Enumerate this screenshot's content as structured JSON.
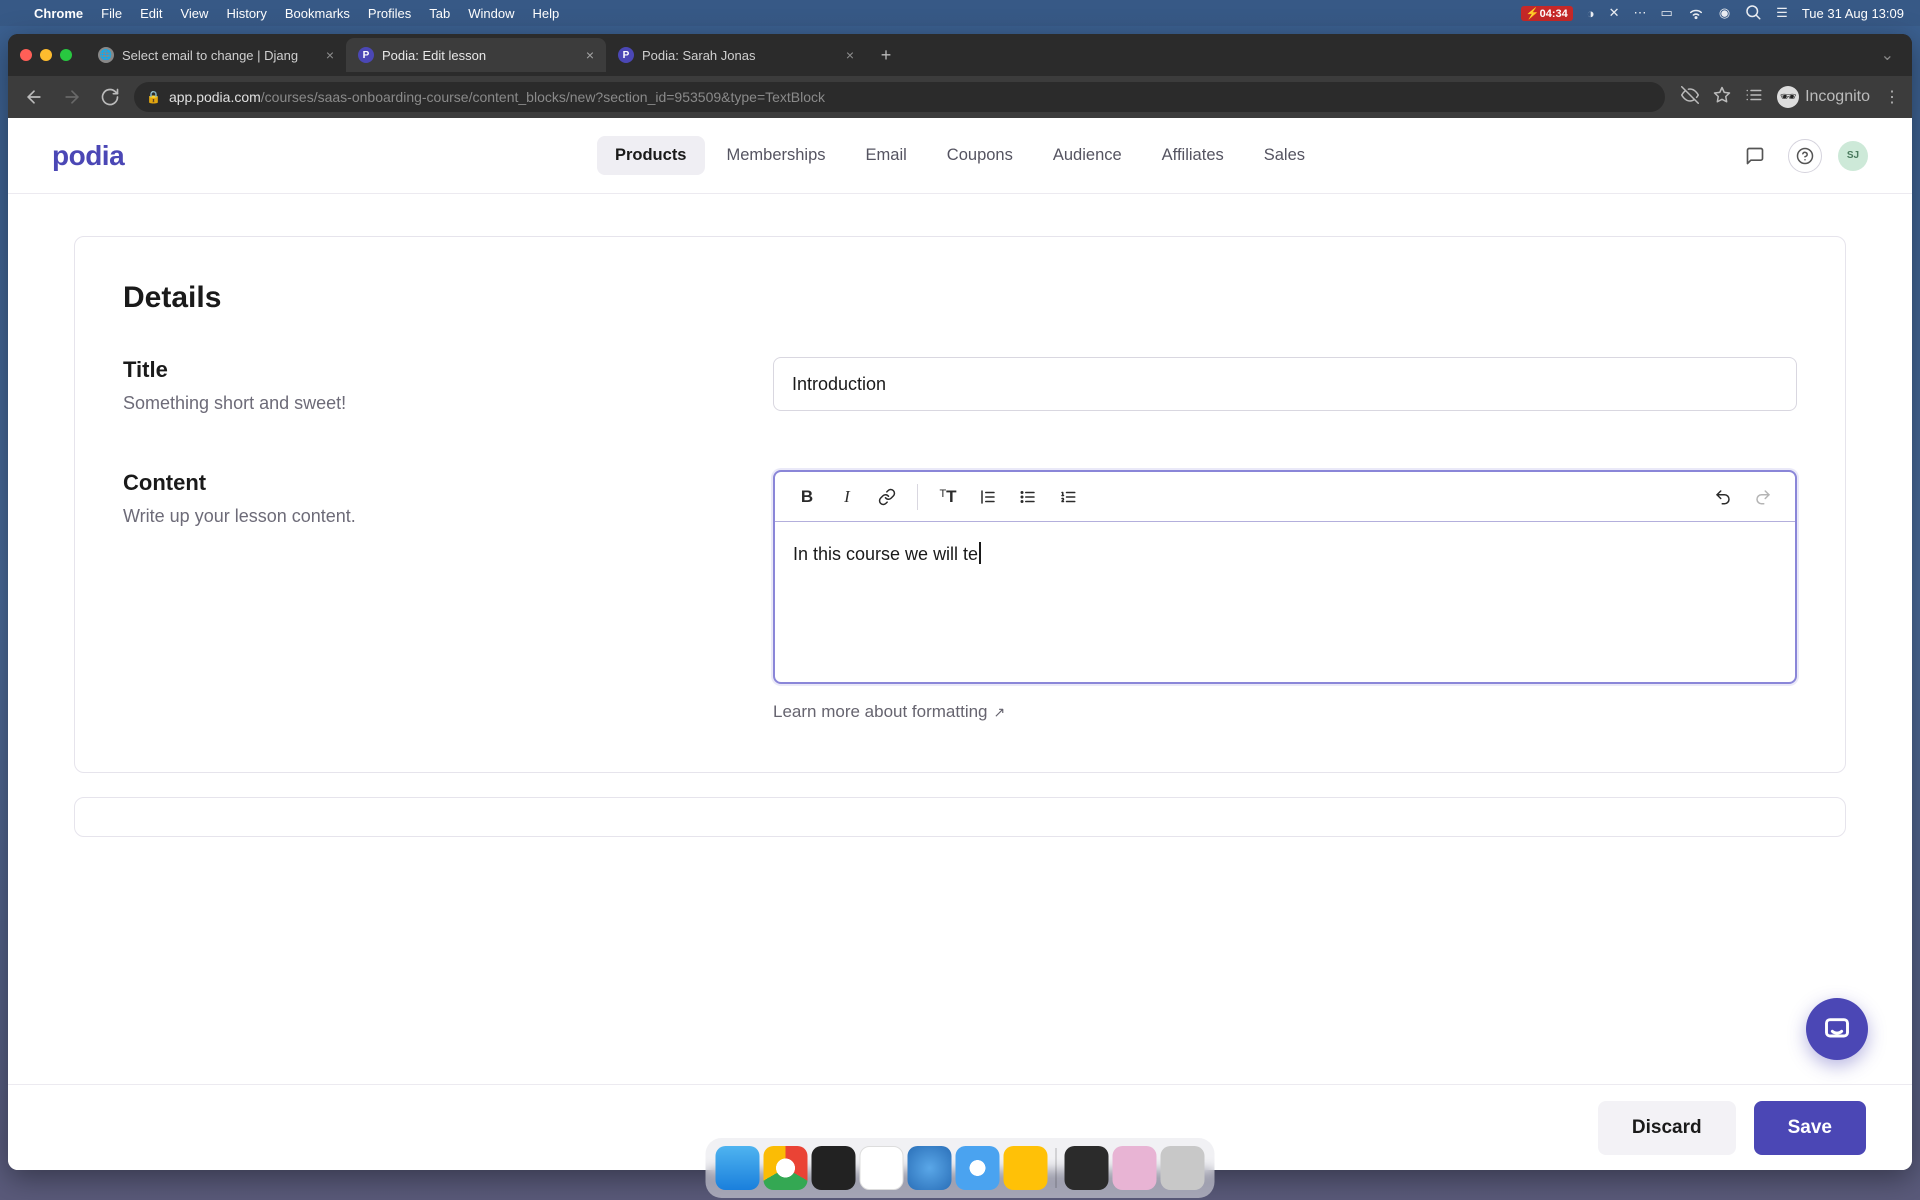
{
  "menubar": {
    "app": "Chrome",
    "items": [
      "File",
      "Edit",
      "View",
      "History",
      "Bookmarks",
      "Profiles",
      "Tab",
      "Window",
      "Help"
    ],
    "battery": "04:34",
    "datetime": "Tue 31 Aug  13:09"
  },
  "tabs": [
    {
      "title": "Select email to change | Djang",
      "fav": "globe",
      "active": false
    },
    {
      "title": "Podia: Edit lesson",
      "fav": "p",
      "active": true
    },
    {
      "title": "Podia: Sarah Jonas",
      "fav": "p",
      "active": false
    }
  ],
  "url": {
    "host": "app.podia.com",
    "path": "/courses/saas-onboarding-course/content_blocks/new?section_id=953509&type=TextBlock"
  },
  "incognito_label": "Incognito",
  "app": {
    "logo": "podia",
    "nav": [
      "Products",
      "Memberships",
      "Email",
      "Coupons",
      "Audience",
      "Affiliates",
      "Sales"
    ],
    "nav_active": "Products",
    "avatar_initials": "SJ"
  },
  "details": {
    "heading": "Details",
    "title_label": "Title",
    "title_help": "Something short and sweet!",
    "title_value": "Introduction",
    "content_label": "Content",
    "content_help": "Write up your lesson content.",
    "content_value": "In this course we will te",
    "learn_more": "Learn more about formatting"
  },
  "footer": {
    "discard": "Discard",
    "save": "Save"
  }
}
